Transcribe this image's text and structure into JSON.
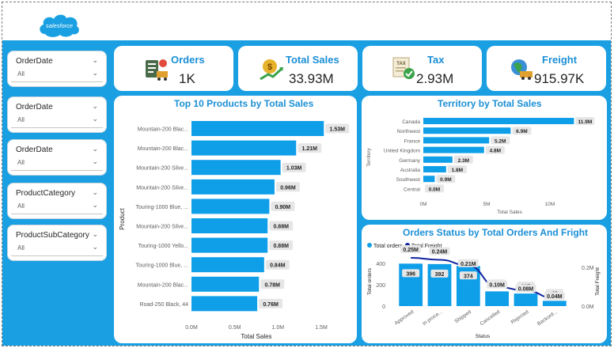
{
  "header": {
    "logo_text": "salesforce"
  },
  "slicers": [
    {
      "label": "OrderDate",
      "value": "All"
    },
    {
      "label": "OrderDate",
      "value": "All"
    },
    {
      "label": "OrderDate",
      "value": "All"
    },
    {
      "label": "ProductCategory",
      "value": "All"
    },
    {
      "label": "ProductSubCategory",
      "value": "All"
    }
  ],
  "kpis": [
    {
      "title": "Orders",
      "value": "1K",
      "icon": "orders-icon"
    },
    {
      "title": "Total Sales",
      "value": "33.93M",
      "icon": "sales-icon"
    },
    {
      "title": "Tax",
      "value": "2.93M",
      "icon": "tax-icon"
    },
    {
      "title": "Freight",
      "value": "915.97K",
      "icon": "freight-icon"
    }
  ],
  "colors": {
    "accent": "#1aa0e2",
    "bar": "#0f9ee8",
    "line": "#12239e",
    "title": "#1a8fd6"
  },
  "chart_data": [
    {
      "type": "bar",
      "orientation": "horizontal",
      "title": "Top 10 Products by Total Sales",
      "xlabel": "Total Sales",
      "ylabel": "Product",
      "xlim": [
        0,
        1.5
      ],
      "xticks": [
        "0.0M",
        "0.5M",
        "1.0M",
        "1.5M"
      ],
      "categories": [
        "Mountain-200 Blac...",
        "Mountain-200 Blac...",
        "Mountain-200 Silve...",
        "Mountain-200 Silve...",
        "Touring-1000 Blue, ...",
        "Mountain-200 Silve...",
        "Touring-1000 Yello...",
        "Touring-1000 Blue, ...",
        "Mountain-200 Blac...",
        "Road-250 Black, 44"
      ],
      "values": [
        1.53,
        1.21,
        1.03,
        0.96,
        0.9,
        0.88,
        0.88,
        0.84,
        0.78,
        0.76
      ],
      "labels": [
        "1.53M",
        "1.21M",
        "1.03M",
        "0.96M",
        "0.90M",
        "0.88M",
        "0.88M",
        "0.84M",
        "0.78M",
        "0.76M"
      ]
    },
    {
      "type": "bar",
      "orientation": "horizontal",
      "title": "Territory by Total Sales",
      "xlabel": "Total Sales",
      "ylabel": "Territory",
      "xlim": [
        0,
        12
      ],
      "xticks": [
        "0M",
        "5M",
        "10M"
      ],
      "xtick_values": [
        0,
        5,
        10
      ],
      "categories": [
        "Canada",
        "Northwest",
        "France",
        "United Kingdom",
        "Germany",
        "Australia",
        "Southwest",
        "Central"
      ],
      "values": [
        11.9,
        6.9,
        5.2,
        4.8,
        2.3,
        1.8,
        0.9,
        0.0
      ],
      "labels": [
        "11.9M",
        "6.9M",
        "5.2M",
        "4.8M",
        "2.3M",
        "1.8M",
        "0.9M",
        "0.0M"
      ]
    },
    {
      "type": "bar",
      "title": "Orders Status by Total Orders And Fright",
      "xlabel": "Status",
      "ylabel": "Total orders",
      "y2label": "Total Freight",
      "legend": [
        "Total orders",
        "Total Freight"
      ],
      "legend_position": "top-left",
      "categories": [
        "Approved",
        "In proce...",
        "Shipped",
        "Cancelled",
        "Rejected",
        "Backord..."
      ],
      "series": [
        {
          "name": "Total orders",
          "type": "bar",
          "values": [
            396,
            392,
            374,
            137,
            117,
            49
          ],
          "labels": [
            "396",
            "392",
            "374",
            "137",
            "117",
            "49"
          ]
        },
        {
          "name": "Total Freight",
          "type": "line",
          "values": [
            0.25,
            0.24,
            0.21,
            0.1,
            0.08,
            0.04
          ],
          "labels": [
            "0.25M",
            "0.24M",
            "0.21M",
            "0.10M",
            "0.08M",
            "0.04M"
          ]
        }
      ],
      "ylim": [
        0,
        450
      ],
      "yticks": [
        "0",
        "200",
        "400"
      ],
      "ytick_values": [
        0,
        200,
        400
      ],
      "y2lim": [
        0,
        0.25
      ],
      "y2ticks": [
        "0.2M",
        "0.0M"
      ],
      "y2tick_values": [
        0.2,
        0.0
      ]
    }
  ]
}
